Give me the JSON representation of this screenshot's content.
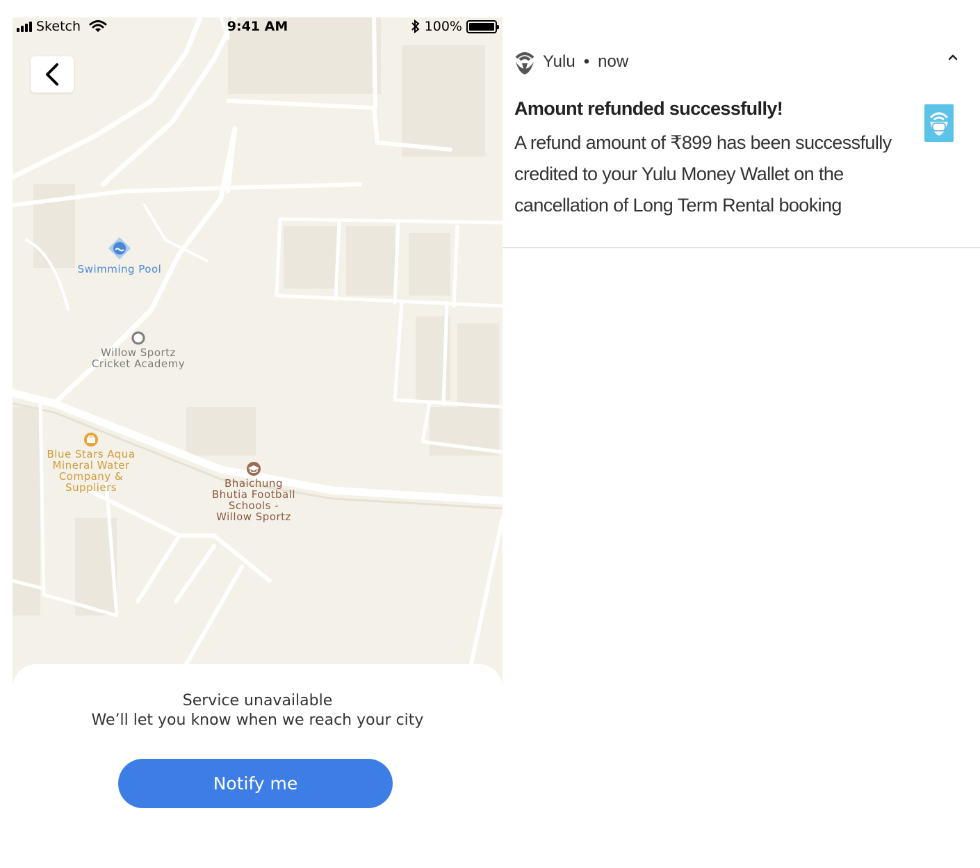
{
  "status_bar": {
    "carrier": "Sketch",
    "time": "9:41 AM",
    "battery": "100%",
    "signal_icon": "signal-bars-icon",
    "wifi_icon": "wifi-icon",
    "bluetooth_icon": "bluetooth-icon",
    "battery_icon": "battery-icon"
  },
  "map": {
    "back_icon": "chevron-left-icon",
    "pois": {
      "pool": "Swimming Pool",
      "willow": "Willow Sportz\nCricket Academy",
      "blue_stars": "Blue Stars Aqua\nMineral Water\nCompany &\nSuppliers",
      "bhaichung": "Bhaichung\nBhutia Football\nSchools -\nWillow Sportz"
    }
  },
  "sheet": {
    "title": "Service unavailable",
    "subtitle": "We’ll let you know when we reach your city",
    "button_label": "Notify me",
    "button_color": "#3d7de6"
  },
  "notification": {
    "app_name": "Yulu",
    "separator": "•",
    "time": "now",
    "title": "Amount refunded successfully!",
    "body": "A refund amount of ₹899 has been successfully credited to your Yulu Money Wallet on the cancellation of Long Term Rental booking",
    "app_icon": "yulu-logo-icon",
    "large_icon": "yulu-masked-icon",
    "expand_icon": "chevron-up-icon",
    "large_icon_color": "#5bc3e8"
  }
}
